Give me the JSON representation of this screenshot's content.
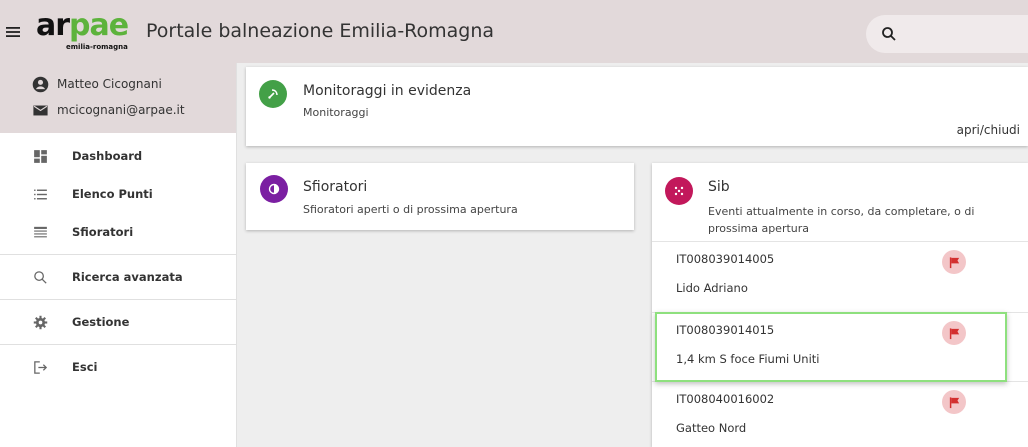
{
  "header": {
    "logo_text": "arpae",
    "logo_subtext": "emilia-romagna",
    "title": "Portale balneazione Emilia-Romagna",
    "colors": {
      "bar": "#e2d9da",
      "logo_accent": "#5db33c"
    }
  },
  "user": {
    "name": "Matteo Cicognani",
    "email": "mcicognani@arpae.it"
  },
  "nav": {
    "dashboard": "Dashboard",
    "elenco_punti": "Elenco Punti",
    "sfioratori": "Sfioratori",
    "ricerca": "Ricerca avanzata",
    "gestione": "Gestione",
    "esci": "Esci"
  },
  "monitoraggi": {
    "title": "Monitoraggi in evidenza",
    "subtitle": "Monitoraggi",
    "toggle": "apri/chiudi",
    "color": "#43a047"
  },
  "sfioratori_card": {
    "title": "Sfioratori",
    "subtitle": "Sfioratori aperti o di prossima apertura",
    "color": "#7b1fa2"
  },
  "sib": {
    "title": "Sib",
    "subtitle": "Eventi attualmente in corso, da completare, o di prossima apertura",
    "color": "#c2185b",
    "items": [
      {
        "code": "IT008039014005",
        "name": "Lido Adriano",
        "flag_color": "#d32f2f"
      },
      {
        "code": "IT008039014015",
        "name": "1,4 km S foce Fiumi Uniti",
        "flag_color": "#d32f2f"
      },
      {
        "code": "IT008040016002",
        "name": "Gatteo Nord",
        "flag_color": "#d32f2f"
      }
    ]
  }
}
